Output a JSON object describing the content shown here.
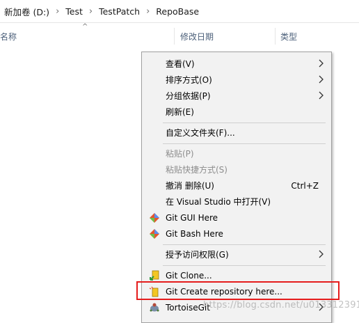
{
  "breadcrumb": [
    "新加卷 (D:)",
    "Test",
    "TestPatch",
    "RepoBase"
  ],
  "columns": {
    "name": "名称",
    "modified": "修改日期",
    "type": "类型"
  },
  "menu": {
    "view": "查看(V)",
    "sort": "排序方式(O)",
    "group": "分组依据(P)",
    "refresh": "刷新(E)",
    "customize": "自定义文件夹(F)...",
    "paste": "粘贴(P)",
    "paste_shortcut": "粘贴快捷方式(S)",
    "undo_delete": "撤消 删除(U)",
    "undo_shortcut": "Ctrl+Z",
    "open_vs": "在 Visual Studio 中打开(V)",
    "git_gui": "Git GUI Here",
    "git_bash": "Git Bash Here",
    "grant_access": "授予访问权限(G)",
    "git_clone": "Git Clone...",
    "git_create": "Git Create repository here...",
    "tortoise": "TortoiseGit"
  },
  "watermark": "https://blog.csdn.net/u013312391",
  "colors": {
    "highlight": "#e51c1c",
    "menu_bg": "#f2f2f2",
    "header_text": "#4c607a"
  },
  "icons": {
    "git_gui": "git-diamond-icon",
    "git_bash": "git-diamond-icon",
    "git_clone": "tortoisegit-clone-icon",
    "git_create": "tortoisegit-create-icon",
    "tortoise": "tortoisegit-icon"
  }
}
